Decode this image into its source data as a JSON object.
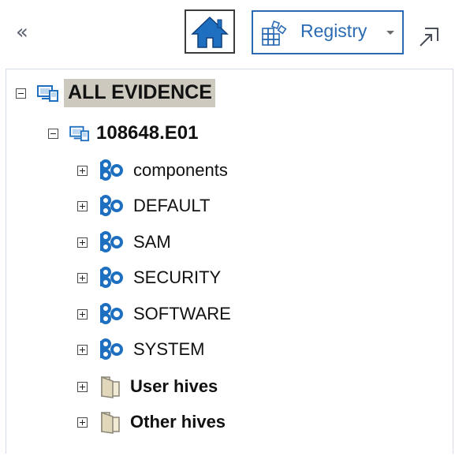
{
  "toolbar": {
    "collapse_glyph": "«",
    "home_icon": "home-icon",
    "registry_label": "Registry",
    "registry_icon": "registry-grid-icon",
    "popout_icon": "popout-arrow-icon"
  },
  "tree": {
    "root": {
      "label": "ALL EVIDENCE",
      "expanded": true
    },
    "evidence": {
      "label": "108648.E01",
      "expanded": true
    },
    "items": [
      {
        "label": "components",
        "icon": "registry-hive-icon",
        "expanded": false,
        "bold": false
      },
      {
        "label": "DEFAULT",
        "icon": "registry-hive-icon",
        "expanded": false,
        "bold": false
      },
      {
        "label": "SAM",
        "icon": "registry-hive-icon",
        "expanded": false,
        "bold": false
      },
      {
        "label": "SECURITY",
        "icon": "registry-hive-icon",
        "expanded": false,
        "bold": false
      },
      {
        "label": "SOFTWARE",
        "icon": "registry-hive-icon",
        "expanded": false,
        "bold": false
      },
      {
        "label": "SYSTEM",
        "icon": "registry-hive-icon",
        "expanded": false,
        "bold": false
      },
      {
        "label": "User hives",
        "icon": "folder-icon",
        "expanded": false,
        "bold": true
      },
      {
        "label": "Other hives",
        "icon": "folder-icon",
        "expanded": false,
        "bold": true
      }
    ]
  },
  "colors": {
    "accent": "#2a6ab3",
    "root_highlight": "#cdc9bf",
    "hive_icon": "#1f6fc0"
  }
}
